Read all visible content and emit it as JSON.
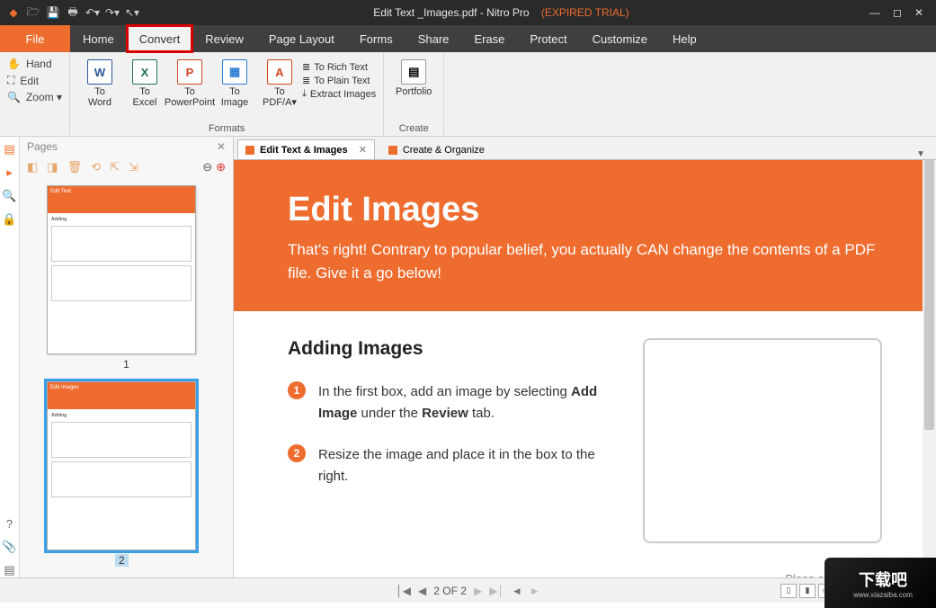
{
  "titlebar": {
    "document": "Edit Text _Images.pdf",
    "app": "Nitro Pro",
    "status": "(EXPIRED TRIAL)"
  },
  "menubar": {
    "file": "File",
    "tabs": [
      "Home",
      "Convert",
      "Review",
      "Page Layout",
      "Forms",
      "Share",
      "Erase",
      "Protect",
      "Customize",
      "Help"
    ],
    "active_index": 1
  },
  "ribbon": {
    "left_tools": [
      {
        "icon": "✋",
        "label": "Hand"
      },
      {
        "icon": "⛶",
        "label": "Edit"
      },
      {
        "icon": "🔍",
        "label": "Zoom ▾"
      }
    ],
    "formats": {
      "big": [
        {
          "glyph": "W",
          "color": "#2b579a",
          "line1": "To",
          "line2": "Word"
        },
        {
          "glyph": "X",
          "color": "#217346",
          "line1": "To",
          "line2": "Excel"
        },
        {
          "glyph": "P",
          "color": "#d24726",
          "line1": "To",
          "line2": "PowerPoint"
        },
        {
          "glyph": "▦",
          "color": "#2b7cd3",
          "line1": "To",
          "line2": "Image"
        },
        {
          "glyph": "A",
          "color": "#d24726",
          "line1": "To",
          "line2": "PDF/A▾"
        }
      ],
      "small": [
        {
          "icon": "≣",
          "label": "To Rich Text"
        },
        {
          "icon": "≣",
          "label": "To Plain Text"
        },
        {
          "icon": "⤓",
          "label": "Extract Images"
        }
      ],
      "label": "Formats"
    },
    "create": {
      "big": [
        {
          "glyph": "▤",
          "color": "#777",
          "line1": "Portfolio",
          "line2": ""
        }
      ],
      "label": "Create"
    }
  },
  "pages_panel": {
    "title": "Pages",
    "thumbs": [
      {
        "number": "1",
        "title": "Edit Text",
        "selected": false
      },
      {
        "number": "2",
        "title": "Edit Images",
        "selected": true
      }
    ]
  },
  "doc_tabs": [
    {
      "label": "Edit Text & Images",
      "active": true
    },
    {
      "label": "Create & Organize",
      "active": false
    }
  ],
  "document": {
    "hero_title": "Edit Images",
    "hero_text": "That's right! Contrary to popular belief, you actually CAN change the contents of a PDF file. Give it a go below!",
    "section_title": "Adding Images",
    "steps": [
      {
        "n": "1",
        "html": "In the first box, add an image by selecting <b>Add Image</b> under the <b>Review</b> tab."
      },
      {
        "n": "2",
        "html": "Resize the image and place it in the box to the right."
      }
    ],
    "caption": "Place an image ab"
  },
  "statusbar": {
    "page_text": "2 OF 2"
  },
  "watermark": {
    "brand": "下载吧",
    "url": "www.xiazaiba.com"
  }
}
